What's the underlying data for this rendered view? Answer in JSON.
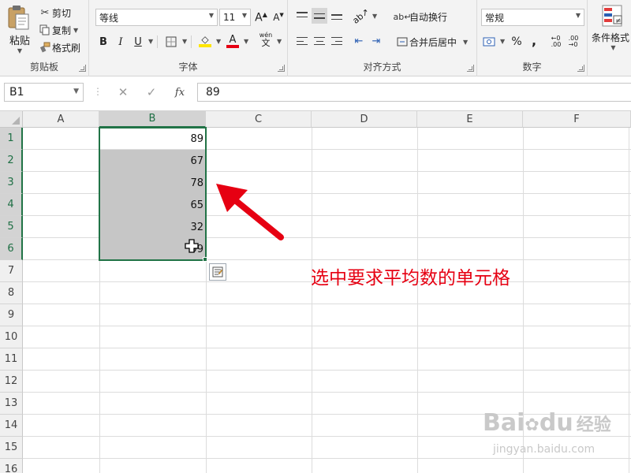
{
  "ribbon": {
    "clipboard": {
      "paste_label": "粘贴",
      "cut_label": "剪切",
      "copy_label": "复制",
      "format_painter_label": "格式刷",
      "group_label": "剪贴板"
    },
    "font": {
      "font_name": "等线",
      "font_size": "11",
      "bold": "B",
      "italic": "I",
      "underline": "U",
      "phonetic_top": "wén",
      "phonetic_bottom": "文",
      "group_label": "字体",
      "highlight_color": "#ffe600",
      "font_color": "#e60012"
    },
    "alignment": {
      "wrap_text_label": "自动换行",
      "merge_center_label": "合并后居中",
      "group_label": "对齐方式"
    },
    "number": {
      "format_value": "常规",
      "percent": "%",
      "comma": ",",
      "group_label": "数字"
    },
    "styles": {
      "conditional_formatting_label": "条件格式"
    }
  },
  "formula_bar": {
    "name_box": "B1",
    "fx_label": "fx",
    "formula_value": "89"
  },
  "sheet": {
    "columns": [
      "A",
      "B",
      "C",
      "D",
      "E",
      "F"
    ],
    "active_column": "B",
    "rows": [
      "1",
      "2",
      "3",
      "4",
      "5",
      "6",
      "7",
      "8",
      "9",
      "10",
      "11",
      "12",
      "13",
      "14",
      "15",
      "16"
    ],
    "active_rows": [
      "1",
      "2",
      "3",
      "4",
      "5",
      "6"
    ],
    "b_values": [
      "89",
      "67",
      "78",
      "65",
      "32",
      "99"
    ],
    "selection_color": "#c6c6c6",
    "selection_border_color": "#217346"
  },
  "annotation": {
    "text": "选中要求平均数的单元格",
    "color": "#e60012"
  },
  "watermark": {
    "brand": "Bai",
    "brand2": "du",
    "suffix": "经验",
    "url": "jingyan.baidu.com"
  }
}
